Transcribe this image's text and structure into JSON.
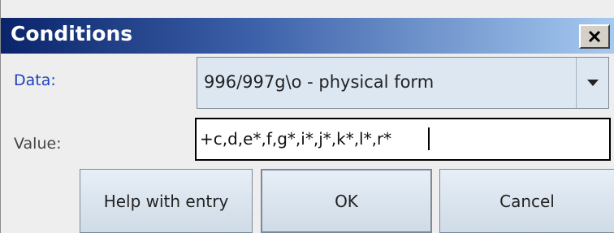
{
  "dialog": {
    "title": "Conditions",
    "close_symbol": "x",
    "close_icon": "close-icon"
  },
  "fields": {
    "data_label": "Data:",
    "data_value": "996/997g\\o - physical form",
    "data_dropdown_icon": "chevron-down-icon",
    "value_label": "Value:",
    "value_text": "+c,d,e*,f,g*,i*,j*,k*,l*,r*"
  },
  "buttons": {
    "help": "Help with entry",
    "ok": "OK",
    "cancel": "Cancel"
  },
  "colors": {
    "title_gradient_start": "#0a246a",
    "title_gradient_end": "#a6caf0",
    "data_label": "#2040c0"
  }
}
